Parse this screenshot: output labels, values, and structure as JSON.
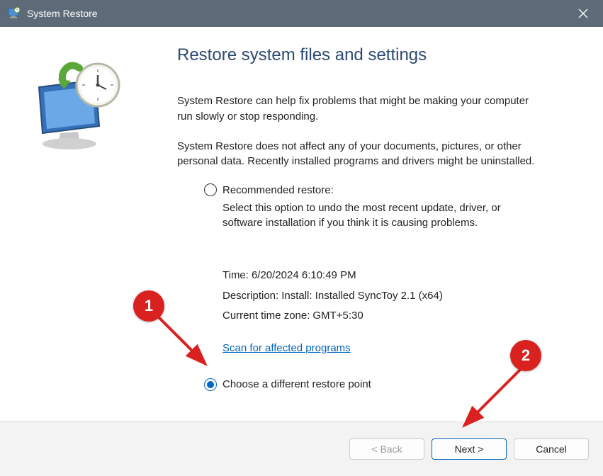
{
  "titlebar": {
    "title": "System Restore"
  },
  "main": {
    "heading": "Restore system files and settings",
    "intro1": "System Restore can help fix problems that might be making your computer run slowly or stop responding.",
    "intro2": "System Restore does not affect any of your documents, pictures, or other personal data. Recently installed programs and drivers might be uninstalled.",
    "recommended": {
      "label": "Recommended restore:",
      "desc": "Select this option to undo the most recent update, driver, or software installation if you think it is causing problems."
    },
    "details": {
      "time_label": "Time:",
      "time_value": "6/20/2024 6:10:49 PM",
      "desc_label": "Description:",
      "desc_value": "Install: Installed SyncToy 2.1 (x64)",
      "tz_label": "Current time zone:",
      "tz_value": "GMT+5:30"
    },
    "scan_link": "Scan for affected programs",
    "different": {
      "label": "Choose a different restore point"
    }
  },
  "footer": {
    "back": "< Back",
    "next": "Next >",
    "cancel": "Cancel"
  },
  "annotations": {
    "one": "1",
    "two": "2"
  }
}
